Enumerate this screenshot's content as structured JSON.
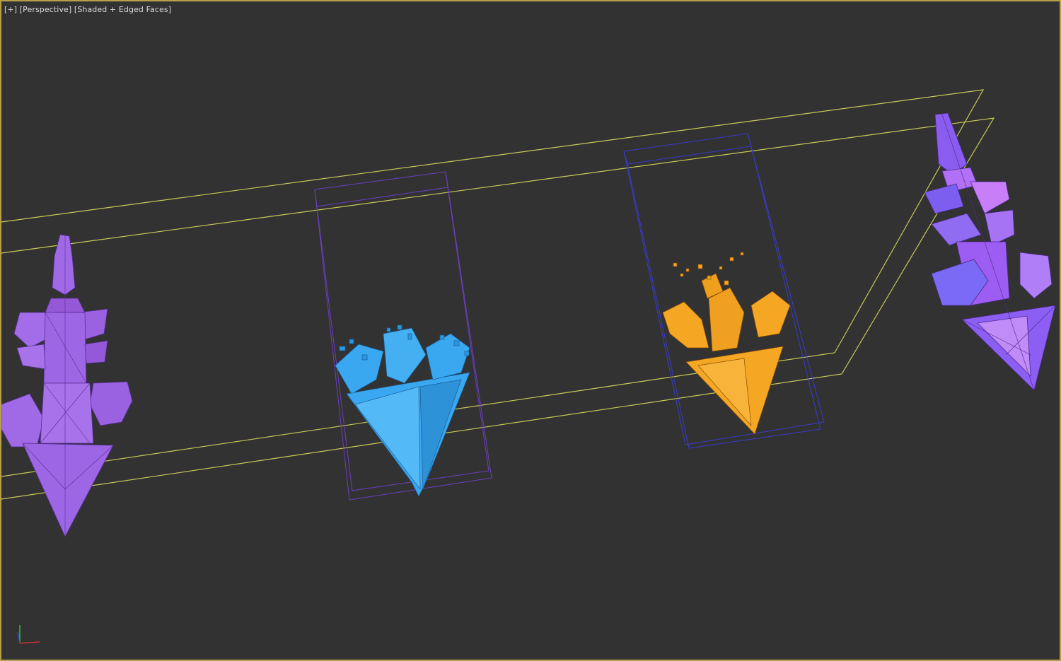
{
  "viewport": {
    "labels": {
      "plus": "[+]",
      "view": "[Perspective]",
      "shading": "[Shaded + Edged Faces]"
    },
    "border_color": "#b8a04a",
    "background_color": "#323232"
  },
  "scene": {
    "objects": [
      {
        "name": "purple-crystal-spear",
        "color": "#9b59e0"
      },
      {
        "name": "blue-crystal-spear-shattering",
        "color": "#3aa8f0"
      },
      {
        "name": "orange-crystal-spear-shattering",
        "color": "#f5a623"
      },
      {
        "name": "violet-crystal-spear",
        "color": "#8a5cf0"
      }
    ],
    "guide_lines_color": "#c9c95a",
    "bbox_colors": [
      "#6a3fc0",
      "#3a3ad0"
    ]
  },
  "gizmo": {
    "axes": [
      "x-axis",
      "y-axis",
      "z-axis"
    ],
    "colors": [
      "#d03030",
      "#30c030",
      "#3050e0"
    ]
  }
}
